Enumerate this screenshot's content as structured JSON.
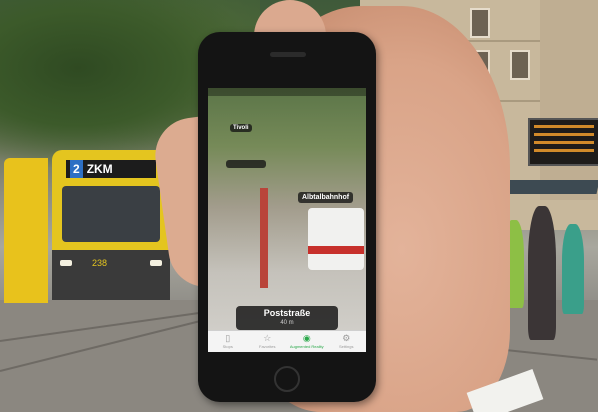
{
  "scene": {
    "tram": {
      "line_number": "2",
      "destination": "ZKM",
      "fleet_id": "238"
    }
  },
  "phone": {
    "status": "",
    "ar_labels": [
      {
        "text": "Tivoli"
      },
      {
        "text": "Albtalbahnhof"
      }
    ],
    "main_poi": {
      "name": "Poststraße",
      "distance": "40 m"
    },
    "tabs": [
      {
        "label": "Stops",
        "icon": "stops-icon",
        "active": false
      },
      {
        "label": "Favorites",
        "icon": "star-icon",
        "active": false
      },
      {
        "label": "Augmented Reality",
        "icon": "eye-icon",
        "active": true
      },
      {
        "label": "Settings",
        "icon": "gear-icon",
        "active": false
      }
    ],
    "colors": {
      "active_tab": "#2aa84a",
      "ar_label_bg": "#191919"
    }
  }
}
